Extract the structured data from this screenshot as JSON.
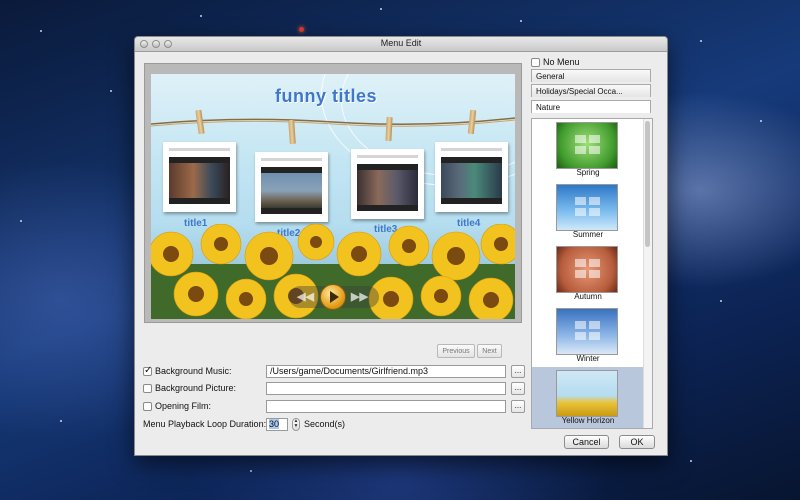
{
  "window": {
    "title": "Menu Edit"
  },
  "preview": {
    "menu_title": "funny titles",
    "titles": [
      "title1",
      "title2",
      "title3",
      "title4"
    ],
    "previous_label": "Previous",
    "next_label": "Next"
  },
  "options": {
    "background_music": {
      "label": "Background Music:",
      "checked": true,
      "value": "/Users/game/Documents/Girlfriend.mp3",
      "browse": "..."
    },
    "background_picture": {
      "label": "Background Picture:",
      "checked": false,
      "value": "",
      "browse": "..."
    },
    "opening_film": {
      "label": "Opening Film:",
      "checked": false,
      "value": "",
      "browse": "..."
    },
    "loop_duration": {
      "label": "Menu Playback Loop Duration:",
      "value": "30",
      "unit": "Second(s)"
    }
  },
  "templates": {
    "no_menu_label": "No Menu",
    "tabs": [
      "General",
      "Holidays/Special Occa...",
      "Nature"
    ],
    "selected_tab": "Nature",
    "items": [
      {
        "name": "Spring",
        "color": "#3f9a2c"
      },
      {
        "name": "Summer",
        "color": "#5aa2e0"
      },
      {
        "name": "Autumn",
        "color": "#b65c3c"
      },
      {
        "name": "Winter",
        "color": "#6a9fd8"
      },
      {
        "name": "Yellow Horizon",
        "color": "#e9c43a"
      }
    ],
    "selected_item": "Yellow Horizon"
  },
  "buttons": {
    "cancel": "Cancel",
    "ok": "OK"
  }
}
